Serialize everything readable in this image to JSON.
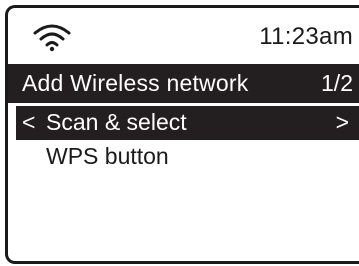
{
  "status_bar": {
    "wifi_icon": "wifi-signal-icon",
    "time": "11:23am"
  },
  "header": {
    "title": "Add Wireless network",
    "page_indicator": "1/2"
  },
  "menu": {
    "items": [
      {
        "back_glyph": "<",
        "label": "Scan & select",
        "forward_glyph": ">",
        "selected": true
      },
      {
        "label": "WPS button",
        "selected": false
      }
    ]
  },
  "colors": {
    "highlight_bg": "#231f20",
    "highlight_fg": "#ffffff",
    "text": "#1a1a1a",
    "background": "#ffffff"
  }
}
